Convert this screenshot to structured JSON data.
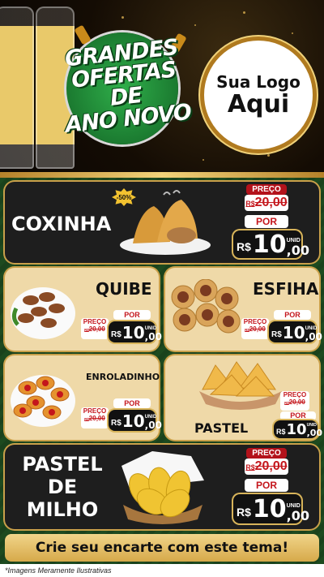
{
  "hero": {
    "headline_lines": [
      "GRANDES",
      "OFERTAS DE",
      "ANO NOVO"
    ],
    "logo_line1": "Sua Logo",
    "logo_line2": "Aqui"
  },
  "labels": {
    "preco": "PREÇO",
    "por": "POR",
    "currency": "R$",
    "unid": "UNID"
  },
  "products": {
    "coxinha": {
      "name": "COXINHA",
      "discount": "-50%",
      "old_price": "20,00",
      "price_int": "10",
      "price_dec": ",00"
    },
    "quibe": {
      "name": "QUIBE",
      "old_price": "20,00",
      "price_int": "10",
      "price_dec": ",00"
    },
    "esfiha": {
      "name": "ESFIHA",
      "old_price": "20,00",
      "price_int": "10",
      "price_dec": ",00"
    },
    "enroladinho": {
      "name": "ENROLADINHO",
      "old_price": "20,00",
      "price_int": "10",
      "price_dec": ",00"
    },
    "pastel": {
      "name": "PASTEL",
      "old_price": "20,00",
      "price_int": "10",
      "price_dec": ",00"
    },
    "pastel_milho": {
      "name_lines": [
        "PASTEL",
        "DE",
        "MILHO"
      ],
      "old_price": "20,00",
      "price_int": "10",
      "price_dec": ",00"
    }
  },
  "cta": "Crie seu encarte com este tema!",
  "footer": "*Imagens Meramente Ilustrativas",
  "colors": {
    "brand_green": "#1b7a30",
    "price_red": "#c4161c",
    "gold": "#c9a04a"
  }
}
